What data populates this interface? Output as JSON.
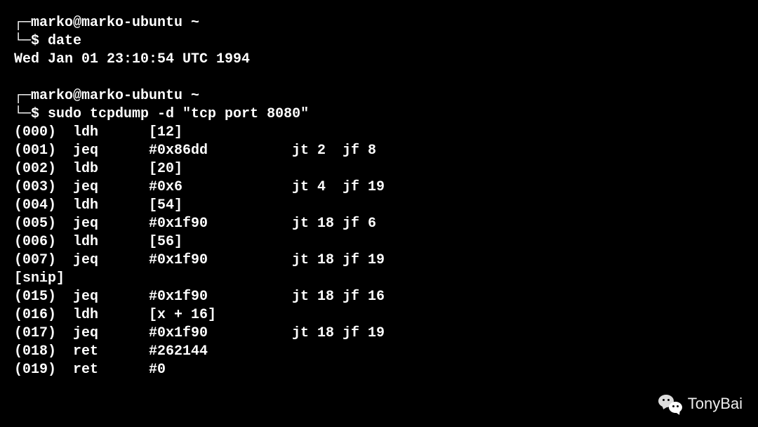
{
  "session1": {
    "prompt_line": "┌─marko@marko-ubuntu ~",
    "command_prefix": "└─$ ",
    "command": "date",
    "output": "Wed Jan 01 23:10:54 UTC 1994"
  },
  "session2": {
    "prompt_line": "┌─marko@marko-ubuntu ~",
    "command_prefix": "└─$ ",
    "command": "sudo tcpdump -d \"tcp port 8080\"",
    "rows": [
      {
        "idx": "(000)",
        "op": "ldh",
        "arg": "[12]",
        "jt": "",
        "jf": ""
      },
      {
        "idx": "(001)",
        "op": "jeq",
        "arg": "#0x86dd",
        "jt": "jt 2",
        "jf": "jf 8"
      },
      {
        "idx": "(002)",
        "op": "ldb",
        "arg": "[20]",
        "jt": "",
        "jf": ""
      },
      {
        "idx": "(003)",
        "op": "jeq",
        "arg": "#0x6",
        "jt": "jt 4",
        "jf": "jf 19"
      },
      {
        "idx": "(004)",
        "op": "ldh",
        "arg": "[54]",
        "jt": "",
        "jf": ""
      },
      {
        "idx": "(005)",
        "op": "jeq",
        "arg": "#0x1f90",
        "jt": "jt 18",
        "jf": "jf 6"
      },
      {
        "idx": "(006)",
        "op": "ldh",
        "arg": "[56]",
        "jt": "",
        "jf": ""
      },
      {
        "idx": "(007)",
        "op": "jeq",
        "arg": "#0x1f90",
        "jt": "jt 18",
        "jf": "jf 19"
      }
    ],
    "snip": "[snip]",
    "rows2": [
      {
        "idx": "(015)",
        "op": "jeq",
        "arg": "#0x1f90",
        "jt": "jt 18",
        "jf": "jf 16"
      },
      {
        "idx": "(016)",
        "op": "ldh",
        "arg": "[x + 16]",
        "jt": "",
        "jf": ""
      },
      {
        "idx": "(017)",
        "op": "jeq",
        "arg": "#0x1f90",
        "jt": "jt 18",
        "jf": "jf 19"
      },
      {
        "idx": "(018)",
        "op": "ret",
        "arg": "#262144",
        "jt": "",
        "jf": ""
      },
      {
        "idx": "(019)",
        "op": "ret",
        "arg": "#0",
        "jt": "",
        "jf": ""
      }
    ]
  },
  "watermark": {
    "label": "TonyBai"
  }
}
